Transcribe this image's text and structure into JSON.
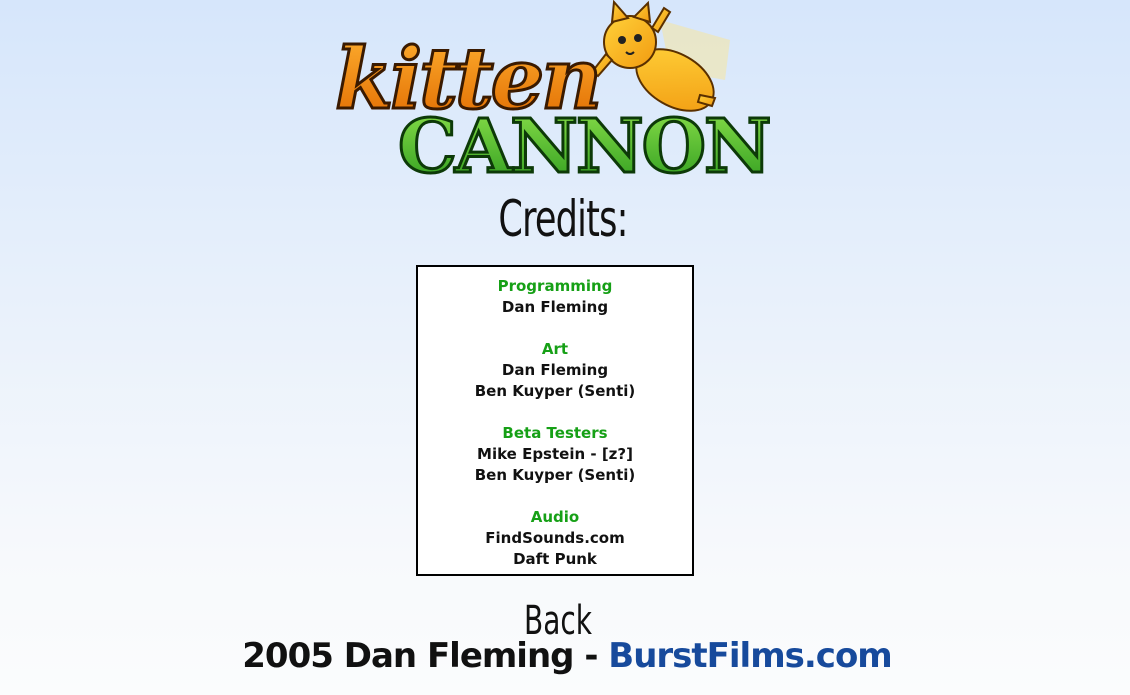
{
  "logo": {
    "line1": "kitten",
    "line2": "CANNON"
  },
  "credits_title": "Credits:",
  "credits": [
    {
      "heading": "Programming",
      "names": [
        "Dan Fleming"
      ]
    },
    {
      "heading": "Art",
      "names": [
        "Dan Fleming",
        "Ben Kuyper (Senti)"
      ]
    },
    {
      "heading": "Beta Testers",
      "names": [
        "Mike Epstein - [z?]",
        "Ben Kuyper (Senti)"
      ]
    },
    {
      "heading": "Audio",
      "names": [
        "FindSounds.com",
        "Daft Punk"
      ]
    }
  ],
  "back_label": "Back",
  "footer": {
    "text": "2005 Dan Fleming - ",
    "link": "BurstFilms.com"
  },
  "colors": {
    "heading": "#16a016",
    "link": "#174a9c",
    "logo_orange": "#f08a12",
    "logo_green": "#3fb62a"
  }
}
